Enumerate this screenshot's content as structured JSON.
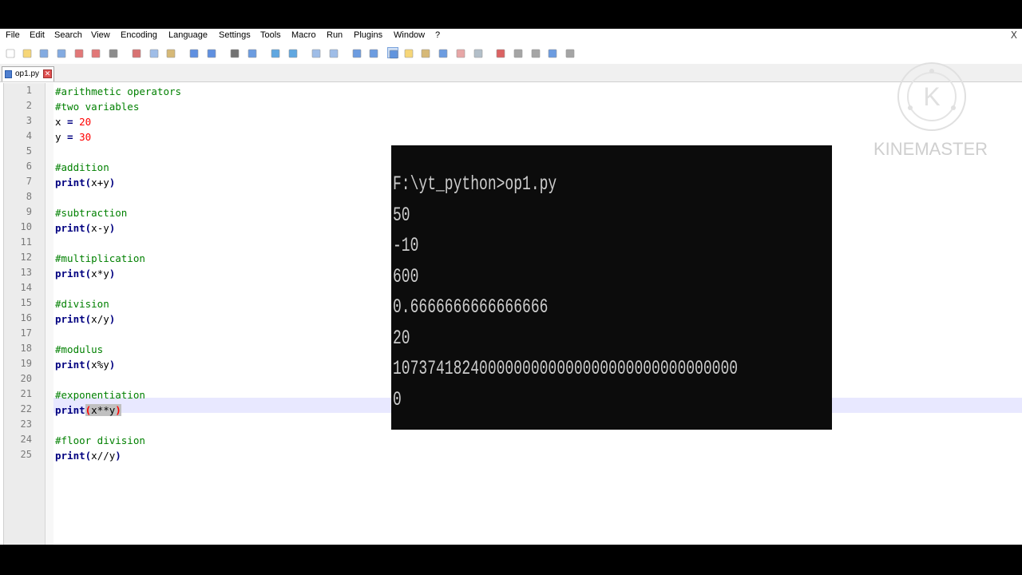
{
  "menubar": {
    "items": [
      "File",
      "Edit",
      "Search",
      "View",
      "Encoding",
      "Language",
      "Settings",
      "Tools",
      "Macro",
      "Run",
      "Plugins",
      "Window",
      "?"
    ],
    "close_label": "X"
  },
  "toolbar": {
    "icons": [
      "new-file-icon",
      "open-file-icon",
      "save-icon",
      "save-all-icon",
      "close-icon",
      "close-all-icon",
      "print-icon",
      "cut-icon",
      "copy-icon",
      "paste-icon",
      "undo-icon",
      "redo-icon",
      "find-icon",
      "replace-icon",
      "zoom-in-icon",
      "zoom-out-icon",
      "sync-vertical-icon",
      "sync-horizontal-icon",
      "word-wrap-icon",
      "show-all-chars-icon",
      "indent-guide-icon",
      "lang-udl-icon",
      "doc-map-icon",
      "function-list-icon",
      "folder-workspace-icon",
      "monitoring-icon",
      "record-macro-icon",
      "stop-record-icon",
      "play-macro-icon",
      "run-macro-multiple-icon",
      "save-macro-icon"
    ]
  },
  "tab": {
    "label": "op1.py"
  },
  "editor": {
    "lines": [
      {
        "n": "1",
        "t": "#arithmetic operators",
        "k": "cm"
      },
      {
        "n": "2",
        "t": "#two variables",
        "k": "cm"
      },
      {
        "n": "3",
        "t": "x = 20",
        "k": "assign"
      },
      {
        "n": "4",
        "t": "y = 30",
        "k": "assign"
      },
      {
        "n": "5",
        "t": "",
        "k": "blank"
      },
      {
        "n": "6",
        "t": "#addition",
        "k": "cm"
      },
      {
        "n": "7",
        "t": "print(x+y)",
        "k": "print"
      },
      {
        "n": "8",
        "t": "",
        "k": "blank"
      },
      {
        "n": "9",
        "t": "#subtraction",
        "k": "cm"
      },
      {
        "n": "10",
        "t": "print(x-y)",
        "k": "print"
      },
      {
        "n": "11",
        "t": "",
        "k": "blank"
      },
      {
        "n": "12",
        "t": "#multiplication",
        "k": "cm"
      },
      {
        "n": "13",
        "t": "print(x*y)",
        "k": "print"
      },
      {
        "n": "14",
        "t": "",
        "k": "blank"
      },
      {
        "n": "15",
        "t": "#division",
        "k": "cm"
      },
      {
        "n": "16",
        "t": "print(x/y)",
        "k": "print"
      },
      {
        "n": "17",
        "t": "",
        "k": "blank"
      },
      {
        "n": "18",
        "t": "#modulus",
        "k": "cm"
      },
      {
        "n": "19",
        "t": "print(x%y)",
        "k": "print"
      },
      {
        "n": "20",
        "t": "",
        "k": "blank"
      },
      {
        "n": "21",
        "t": "#exponentiation",
        "k": "cm"
      },
      {
        "n": "22",
        "t": "print(x**y)",
        "k": "print"
      },
      {
        "n": "23",
        "t": "",
        "k": "blank"
      },
      {
        "n": "24",
        "t": "#floor division",
        "k": "cm"
      },
      {
        "n": "25",
        "t": "print(x//y)",
        "k": "print"
      }
    ]
  },
  "console": {
    "lines": [
      "F:\\yt_python>op1.py",
      "50",
      "-10",
      "600",
      "0.6666666666666666",
      "20",
      "1073741824000000000000000000000000000000",
      "0"
    ]
  },
  "watermark": {
    "text": "KINEMASTER"
  },
  "colors": {
    "comment": "#008000",
    "keyword": "#000080",
    "number": "#ff0000",
    "console_bg": "#0c0c0c",
    "console_fg": "#cccccc"
  }
}
